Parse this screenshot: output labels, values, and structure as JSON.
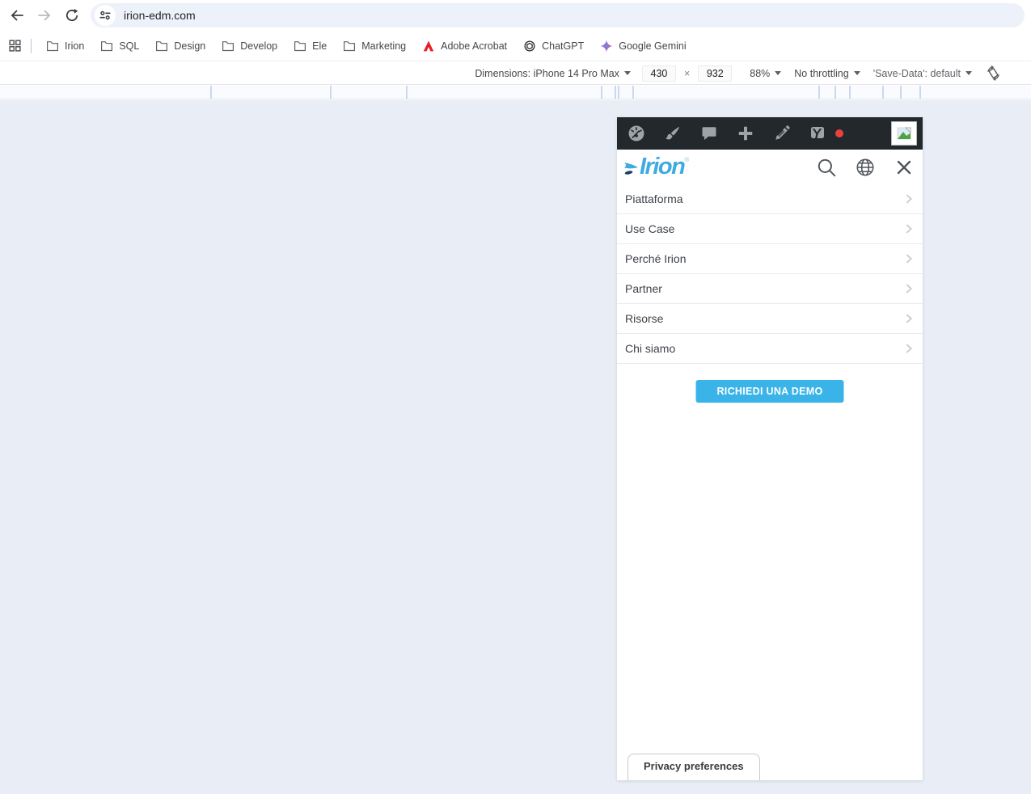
{
  "colors": {
    "brand_blue": "#3FABE0",
    "demo_button_blue": "#3AB4E8",
    "admin_bar_bg": "#23282D",
    "notification_red": "#E5443B",
    "canvas_bg": "#E9EDF5"
  },
  "browser": {
    "url": "irion-edm.com",
    "nav_icons": [
      "back",
      "forward",
      "reload",
      "site-settings-tune"
    ],
    "bookmarks": [
      {
        "label": "Irion",
        "icon": "folder"
      },
      {
        "label": "SQL",
        "icon": "folder"
      },
      {
        "label": "Design",
        "icon": "folder"
      },
      {
        "label": "Develop",
        "icon": "folder"
      },
      {
        "label": "Ele",
        "icon": "folder"
      },
      {
        "label": "Marketing",
        "icon": "folder"
      },
      {
        "label": "Adobe Acrobat",
        "icon": "adobe-logo"
      },
      {
        "label": "ChatGPT",
        "icon": "chatgpt-logo"
      },
      {
        "label": "Google Gemini",
        "icon": "gemini-logo"
      }
    ]
  },
  "devtools": {
    "dimensions_label": "Dimensions: iPhone 14 Pro Max",
    "width": "430",
    "multiply_sign": "×",
    "height": "932",
    "zoom": "88%",
    "throttling": "No throttling",
    "save_data": "'Save-Data': default",
    "rotate_icon": "rotate-device"
  },
  "page": {
    "admin_bar": {
      "icons": [
        "gauge",
        "paintbrush",
        "comments-bubble",
        "plus",
        "edit-pencil",
        "yoast-seo",
        "notification-dot",
        "broken-image"
      ]
    },
    "header": {
      "logo_text": "Irion",
      "registered_mark": "®",
      "icons": [
        "search",
        "globe-language",
        "close-menu"
      ]
    },
    "menu": {
      "items": [
        {
          "label": "Piattaforma"
        },
        {
          "label": "Use Case"
        },
        {
          "label": "Perché Irion"
        },
        {
          "label": "Partner"
        },
        {
          "label": "Risorse"
        },
        {
          "label": "Chi siamo"
        }
      ]
    },
    "demo_button_label": "RICHIEDI UNA DEMO",
    "privacy_button_label": "Privacy preferences"
  }
}
